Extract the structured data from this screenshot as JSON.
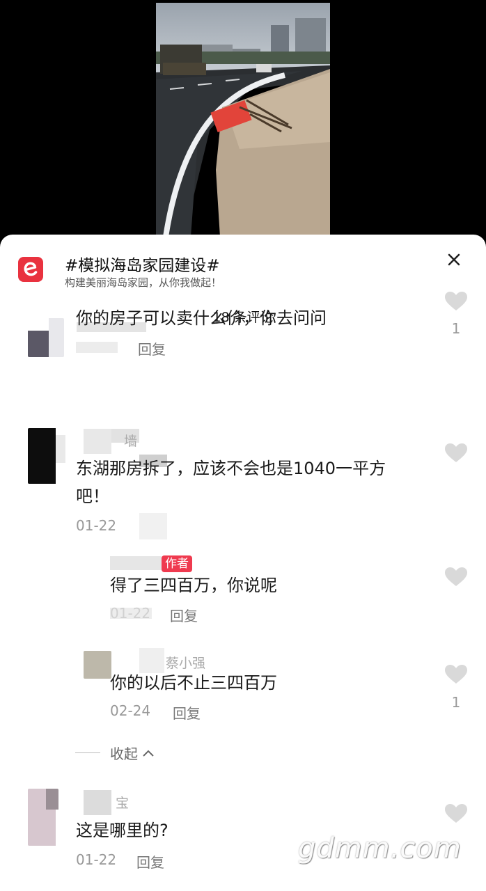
{
  "topic": {
    "title": "#模拟海岛家园建设#",
    "subtitle": "构建美丽海岛家园，从你我做起！"
  },
  "comment_count_label": "18 条评论",
  "comments": [
    {
      "text": "你的房子可以卖什么价，你去问问",
      "date": "",
      "reply_label": "回复",
      "likes": "1"
    },
    {
      "username": "墙",
      "text_line1": "东湖那房拆了，应该不会也是1040一平方",
      "text_line2": "吧！",
      "date": "01-22",
      "likes": ""
    },
    {
      "is_reply": true,
      "author_badge": "作者",
      "text": "得了三四百万，你说呢",
      "date": "01-22",
      "reply_label": "回复",
      "likes": ""
    },
    {
      "is_reply": true,
      "username": "蔡小强",
      "text": "你的以后不止三四百万",
      "date": "02-24",
      "reply_label": "回复",
      "likes": "1"
    },
    {
      "username": "宝",
      "text": "这是哪里的?",
      "date": "01-22",
      "reply_label": "回复",
      "likes": ""
    }
  ],
  "collapse_label": "收起",
  "watermark": "gdmm.com",
  "colors": {
    "accent": "#e9323f",
    "badge": "#ef3a4f",
    "heart": "#d9d9d9"
  }
}
